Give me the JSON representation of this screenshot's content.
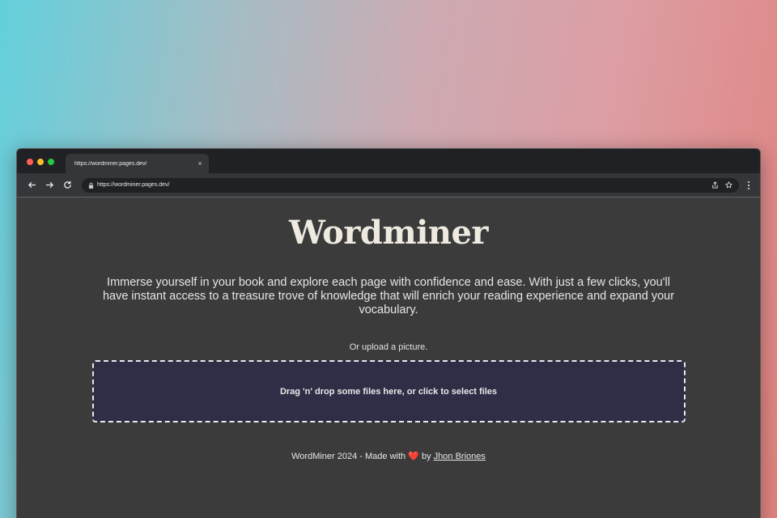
{
  "browser": {
    "tab_title": "https://wordminer.pages.dev/",
    "tab_close": "×",
    "url": "https://wordminer.pages.dev/"
  },
  "page": {
    "title": "Wordminer",
    "intro": "Immerse yourself in your book and explore each page with confidence and ease. With just a few clicks, you'll have instant access to a treasure trove of knowledge that will enrich your reading experience and expand your vocabulary.",
    "upload_label": "Or upload a picture.",
    "dropzone_text": "Drag 'n' drop some files here, or click to select files"
  },
  "footer": {
    "prefix": "WordMiner 2024 - Made with",
    "heart": "❤️",
    "by": "by",
    "author": "Jhon Briones"
  },
  "colors": {
    "window_bg": "#3b3b3b",
    "dropzone_bg": "#2e2f47",
    "title": "#eeeae0"
  }
}
